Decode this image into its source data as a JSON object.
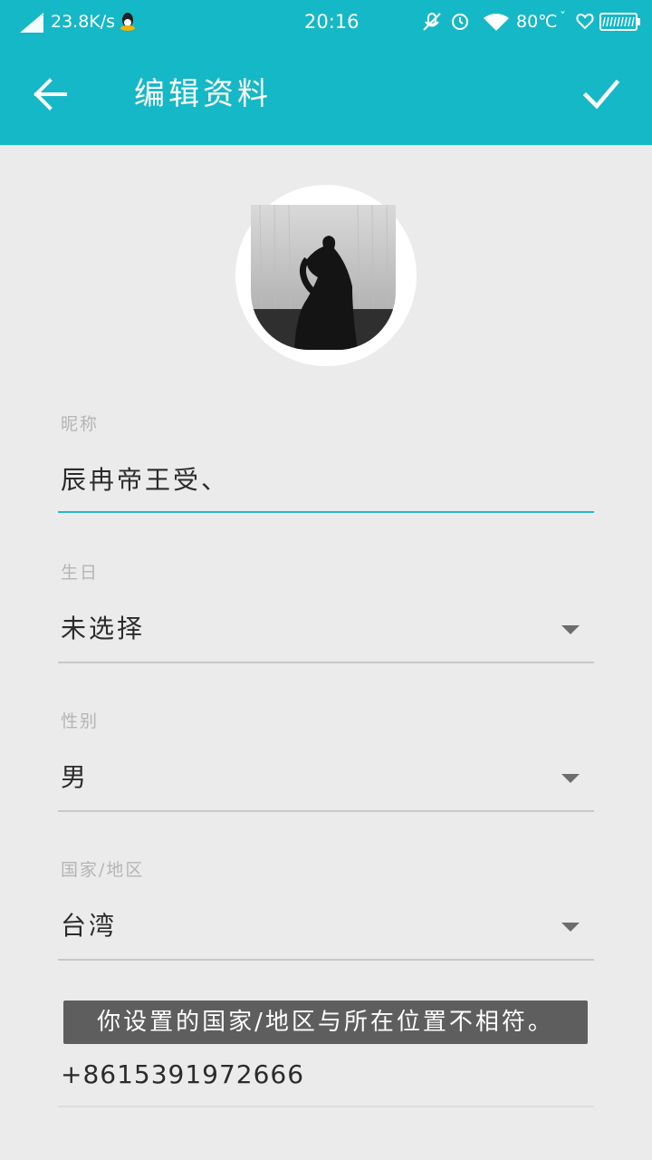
{
  "status_bar": {
    "net_speed": "23.8K/s",
    "time": "20:16",
    "temperature": "80℃",
    "icons": [
      "signal-icon",
      "qq-icon",
      "mic-off-icon",
      "alarm-icon",
      "wifi-icon",
      "heart-icon",
      "battery-icon"
    ]
  },
  "toolbar": {
    "title": "编辑资料",
    "back_icon": "arrow-left-icon",
    "confirm_icon": "check-icon",
    "background": "#15b8c6"
  },
  "avatar": {
    "description_icon": "avatar-photo"
  },
  "form": {
    "nickname": {
      "label": "昵称",
      "value": "辰冉帝王受、"
    },
    "birthday": {
      "label": "生日",
      "value": "未选择"
    },
    "gender": {
      "label": "性别",
      "value": "男"
    },
    "region": {
      "label": "国家/地区",
      "value": "台湾"
    },
    "phone": {
      "value": "+8615391972666"
    }
  },
  "toast": {
    "message": "你设置的国家/地区与所在位置不相符。"
  },
  "colors": {
    "accent": "#29b7c6",
    "page_bg": "#ebebeb",
    "toast_bg": "#5e5e5e"
  }
}
